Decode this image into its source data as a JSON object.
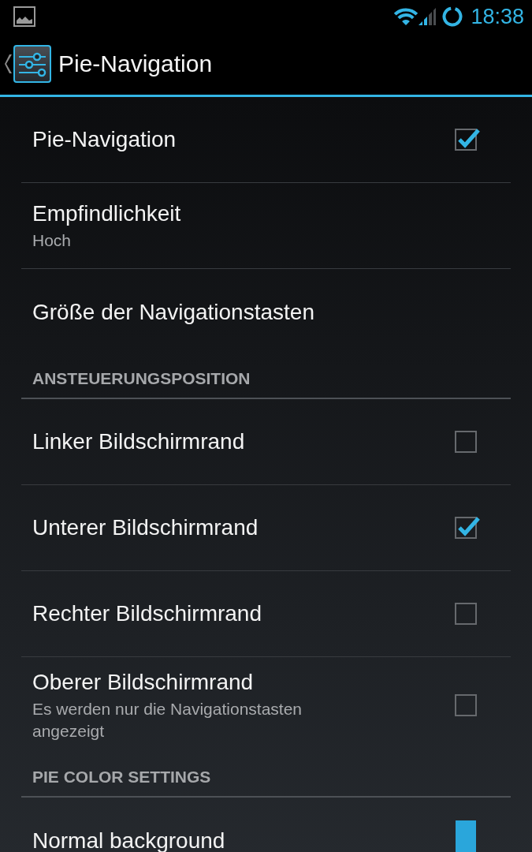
{
  "status_bar": {
    "time": "18:38"
  },
  "action_bar": {
    "title": "Pie-Navigation"
  },
  "sections": [
    {
      "items": [
        {
          "kind": "checkbox",
          "title": "Pie-Navigation",
          "checked": true
        },
        {
          "kind": "plain",
          "title": "Empfindlichkeit",
          "summary": "Hoch"
        },
        {
          "kind": "plain",
          "title": "Größe der Navigationstasten"
        }
      ]
    },
    {
      "header": "ANSTEUERUNGSPOSITION",
      "items": [
        {
          "kind": "checkbox",
          "title": "Linker Bildschirmrand",
          "checked": false
        },
        {
          "kind": "checkbox",
          "title": "Unterer Bildschirmrand",
          "checked": true
        },
        {
          "kind": "checkbox",
          "title": "Rechter Bildschirmrand",
          "checked": false
        },
        {
          "kind": "checkbox",
          "title": "Oberer Bildschirmrand",
          "summary": "Es werden nur die Navigationstasten angezeigt",
          "checked": false
        }
      ]
    },
    {
      "header": "PIE COLOR SETTINGS",
      "items": [
        {
          "kind": "color",
          "title": "Normal background",
          "color": "#2aa6db"
        }
      ]
    }
  ]
}
